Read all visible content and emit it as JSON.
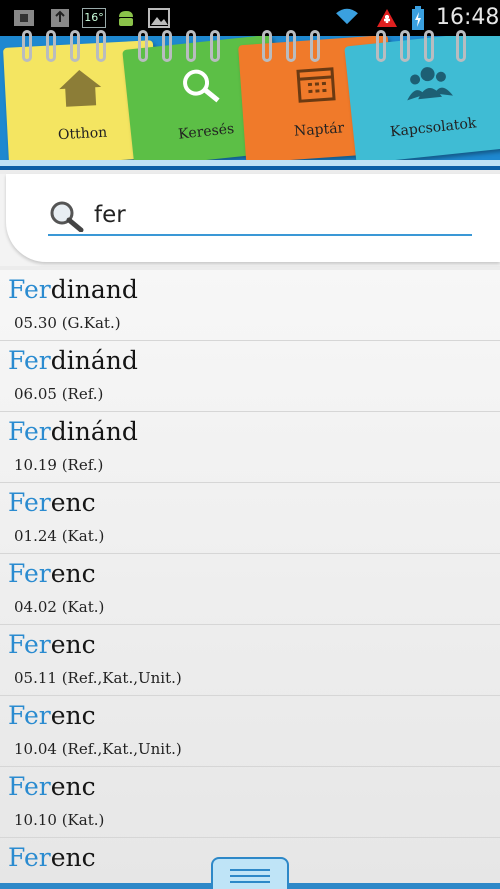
{
  "status_bar": {
    "temperature": "16°",
    "time": "16:48"
  },
  "tabs": [
    {
      "label": "Otthon",
      "icon": "house-icon",
      "color": "#f4e561"
    },
    {
      "label": "Keresés",
      "icon": "search-icon",
      "color": "#5cbf46"
    },
    {
      "label": "Naptár",
      "icon": "calendar-icon",
      "color": "#f07a2a"
    },
    {
      "label": "Kapcsolatok",
      "icon": "people-icon",
      "color": "#3fbcd4"
    }
  ],
  "search": {
    "value": "fer",
    "placeholder": ""
  },
  "results": [
    {
      "match": "Fer",
      "rest": "dinand",
      "date": "05.30 (G.Kat.)"
    },
    {
      "match": "Fer",
      "rest": "dinánd",
      "date": "06.05 (Ref.)"
    },
    {
      "match": "Fer",
      "rest": "dinánd",
      "date": "10.19 (Ref.)"
    },
    {
      "match": "Fer",
      "rest": "enc",
      "date": "01.24 (Kat.)"
    },
    {
      "match": "Fer",
      "rest": "enc",
      "date": "04.02 (Kat.)"
    },
    {
      "match": "Fer",
      "rest": "enc",
      "date": "05.11 (Ref.,Kat.,Unit.)"
    },
    {
      "match": "Fer",
      "rest": "enc",
      "date": "10.04 (Ref.,Kat.,Unit.)"
    },
    {
      "match": "Fer",
      "rest": "enc",
      "date": "10.10 (Kat.)"
    },
    {
      "match": "Fer",
      "rest": "enc",
      "date": ""
    }
  ],
  "colors": {
    "accent": "#2a8bd0",
    "header_bg": "#1e88d0"
  }
}
